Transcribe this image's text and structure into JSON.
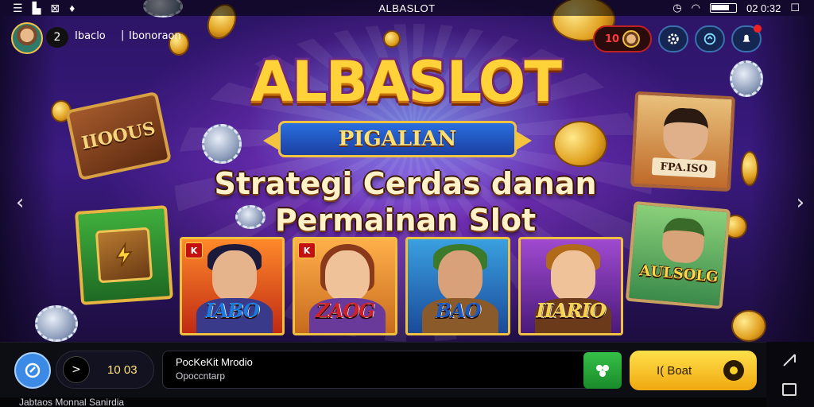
{
  "status_bar": {
    "title": "ALBASLOT",
    "time": "02 0:32",
    "icons": [
      "menu-icon",
      "chart-icon",
      "image-x-icon",
      "controller-icon",
      "alarm-icon",
      "wifi-icon",
      "battery-icon",
      "close-box-icon"
    ]
  },
  "hud": {
    "level": "2",
    "player_name": "Ibaclo",
    "separator": "|",
    "player_tag": "Ibonoraon",
    "coin_value": "10",
    "buttons": [
      "gear-icon",
      "share-icon",
      "notification-icon"
    ]
  },
  "hero": {
    "logo_title": "ALBASLOT",
    "logo_subtitle": "PIGALIAN",
    "headline_line1": "Strategi Cerdas danan",
    "headline_line2": "Permainan Slot"
  },
  "side_items": {
    "left_chest_label": "IIOOUS",
    "right_top_plate": "FPA.ISO",
    "right_bottom_plate": "AULSOLG"
  },
  "game_cards": [
    {
      "name": "IABO",
      "tag": "K"
    },
    {
      "name": "ZAOG",
      "tag": "K"
    },
    {
      "name": "BAO",
      "tag": ""
    },
    {
      "name": "IIARIO",
      "tag": ""
    }
  ],
  "bottom_bar": {
    "counter_value": "10 03",
    "counter_arrow": ">",
    "field_line1": "PocKeKit Mrodio",
    "field_line2": "Opoccntarp",
    "play_label": "I( Boat"
  },
  "footer_text": "Jabtaos Monnal Sanirdia",
  "colors": {
    "accent_gold": "#ffd23a",
    "play_button": "#ffe04a",
    "green_button": "#36c048",
    "hud_blue": "#3a8ae6",
    "coin_red": "#ff3b3b"
  }
}
